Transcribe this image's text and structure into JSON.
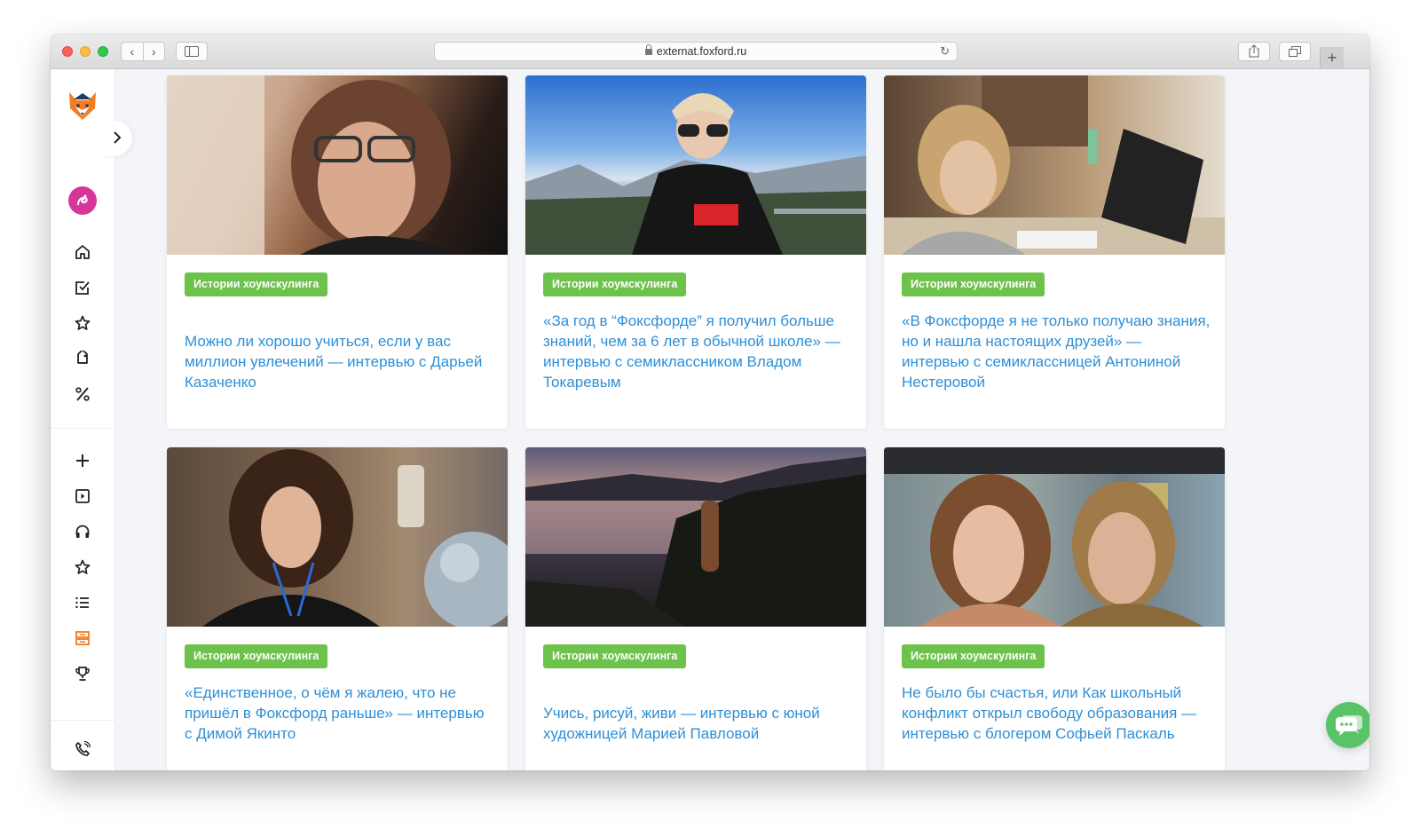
{
  "browser": {
    "url": "externat.foxford.ru",
    "back_label": "‹",
    "forward_label": "›",
    "new_tab_label": "+"
  },
  "rail": {
    "expand_icon": "chevron-right-icon",
    "top_icons": [
      "home-icon",
      "checkbox-icon",
      "star-icon",
      "tag-icon",
      "percent-icon"
    ],
    "bottom_icons": [
      "plus-icon",
      "play-square-icon",
      "headphones-icon",
      "star-icon",
      "list-icon",
      "layers-icon",
      "trophy-icon"
    ],
    "footer_icon": "phone-icon",
    "accent_color": "#f47b20"
  },
  "cards": [
    {
      "badge": "Истории хоумскулинга",
      "title": "Можно ли хорошо учиться, если у вас миллион увлечений — интервью с Дарьей Казаченко"
    },
    {
      "badge": "Истории хоумскулинга",
      "title": "«За год в “Фоксфорде” я получил больше знаний, чем за 6 лет в обычной школе» — интервью с семиклассником Владом Токаревым"
    },
    {
      "badge": "Истории хоумскулинга",
      "title": "«В Фоксфорде я не только получаю знания, но и нашла настоящих друзей» — интервью с семиклассницей Антониной Нестеровой"
    },
    {
      "badge": "Истории хоумскулинга",
      "title": "«Единственное, о чём я жалею, что не пришёл в Фоксфорд раньше» — интервью с Димой Якинто"
    },
    {
      "badge": "Истории хоумскулинга",
      "title": "Учись, рисуй, живи — интервью с юной художницей Марией Павловой"
    },
    {
      "badge": "Истории хоумскулинга",
      "title": "Не было бы счастья, или Как школьный конфликт открыл свободу образования — интервью с блогером Софьей Паскаль"
    }
  ],
  "colors": {
    "badge": "#6cc24a",
    "link": "#2e8fd6",
    "chat": "#59c36a"
  }
}
